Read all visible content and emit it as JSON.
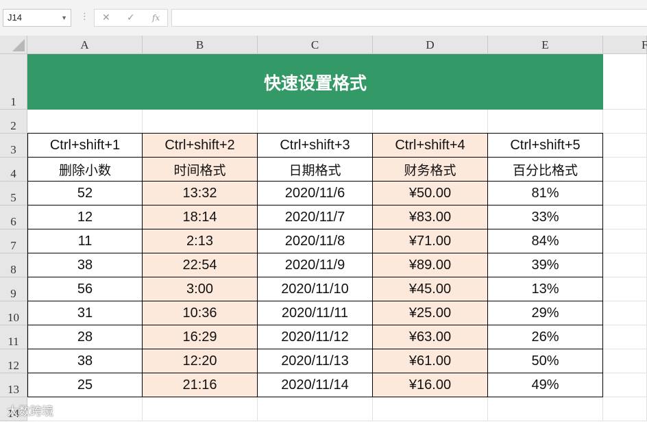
{
  "formula_bar": {
    "name_box": "J14",
    "cancel_glyph": "✕",
    "enter_glyph": "✓",
    "fx_label": "fx",
    "formula": ""
  },
  "columns": [
    "A",
    "B",
    "C",
    "D",
    "E",
    "F"
  ],
  "rows": [
    "1",
    "2",
    "3",
    "4",
    "5",
    "6",
    "7",
    "8",
    "9",
    "10",
    "11",
    "12",
    "13",
    "14"
  ],
  "sheet": {
    "title": "快速设置格式",
    "shortcuts": [
      "Ctrl+shift+1",
      "Ctrl+shift+2",
      "Ctrl+shift+3",
      "Ctrl+shift+4",
      "Ctrl+shift+5"
    ],
    "formats": [
      "删除小数",
      "时间格式",
      "日期格式",
      "财务格式",
      "百分比格式"
    ],
    "data": [
      [
        "52",
        "13:32",
        "2020/11/6",
        "¥50.00",
        "81%"
      ],
      [
        "12",
        "18:14",
        "2020/11/7",
        "¥83.00",
        "33%"
      ],
      [
        "11",
        "2:13",
        "2020/11/8",
        "¥71.00",
        "84%"
      ],
      [
        "38",
        "22:54",
        "2020/11/9",
        "¥89.00",
        "39%"
      ],
      [
        "56",
        "3:00",
        "2020/11/10",
        "¥45.00",
        "13%"
      ],
      [
        "31",
        "10:36",
        "2020/11/11",
        "¥25.00",
        "29%"
      ],
      [
        "28",
        "16:29",
        "2020/11/12",
        "¥63.00",
        "26%"
      ],
      [
        "38",
        "12:20",
        "2020/11/13",
        "¥61.00",
        "50%"
      ],
      [
        "25",
        "21:16",
        "2020/11/14",
        "¥16.00",
        "49%"
      ]
    ]
  },
  "watermark": "大数跨境",
  "colors": {
    "title_fill": "#339966",
    "highlight_fill": "#fde9dc"
  }
}
